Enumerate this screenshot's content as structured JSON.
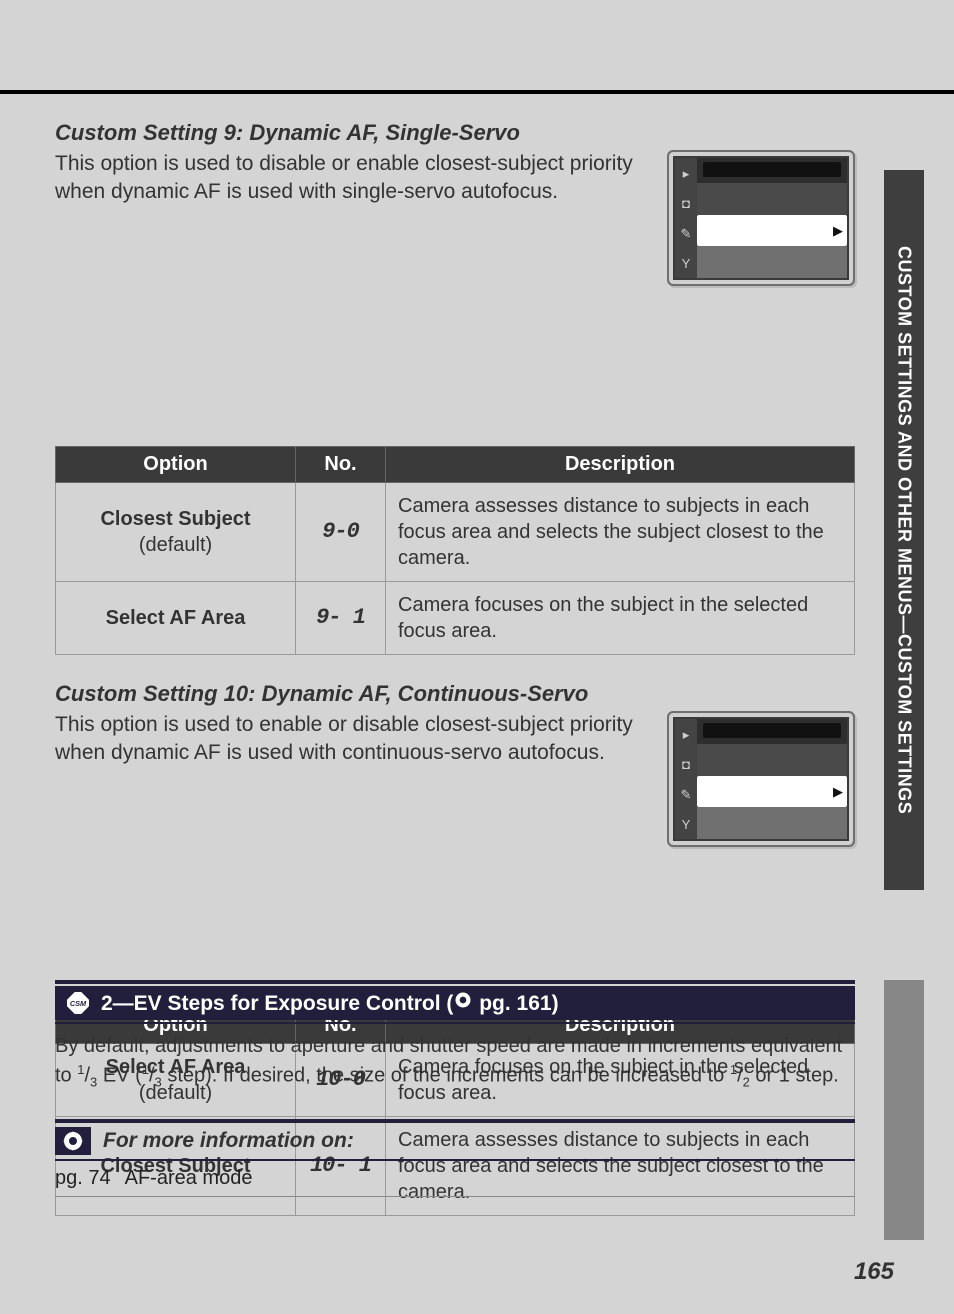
{
  "sidebar_label": "CUSTOM SETTINGS AND OTHER MENUS—CUSTOM SETTINGS",
  "page_number": "165",
  "section1": {
    "title": "Custom Setting 9: Dynamic AF, Single-Servo",
    "body": "This option is used to disable or enable closest-subject priority when dynamic AF is used with single-servo autofocus."
  },
  "section2": {
    "title": "Custom Setting 10: Dynamic AF, Continuous-Servo",
    "body": "This option is used to enable or disable closest-subject priority when dynamic AF is used with continuous-servo autofocus."
  },
  "table_headers": {
    "option": "Option",
    "no": "No.",
    "description": "Description"
  },
  "table1": [
    {
      "name": "Closest Subject",
      "sub": "(default)",
      "no": "9-0",
      "desc": "Camera assesses distance to subjects in each focus area and selects the subject closest to the camera."
    },
    {
      "name": "Select AF Area",
      "sub": "",
      "no": "9- 1",
      "desc": "Camera focuses on the subject in the selected focus area."
    }
  ],
  "table2": [
    {
      "name": "Select AF Area",
      "sub": "(default)",
      "no": "10-0",
      "desc": "Camera focuses on the subject in the selected focus area."
    },
    {
      "name": "Closest Subject",
      "sub": "",
      "no": "10- 1",
      "desc": "Camera assesses distance to subjects in each focus area and selects the subject closest to the camera."
    }
  ],
  "ev_section": {
    "title_prefix": "2—EV Steps for Exposure Control (",
    "title_suffix": " pg. 161)",
    "body_a": "By default, adjustments to aperture and shutter speed are made in increments equivalent to ",
    "body_b": " EV (",
    "body_c": " step).  If desired, the size of the increments can be increased to ",
    "body_d": " or 1 step."
  },
  "fractions": {
    "one": "1",
    "three": "3",
    "two": "2"
  },
  "more_info": {
    "title": "For more information on:",
    "ref_pg": "pg. 74",
    "ref_label": "AF-area mode"
  }
}
